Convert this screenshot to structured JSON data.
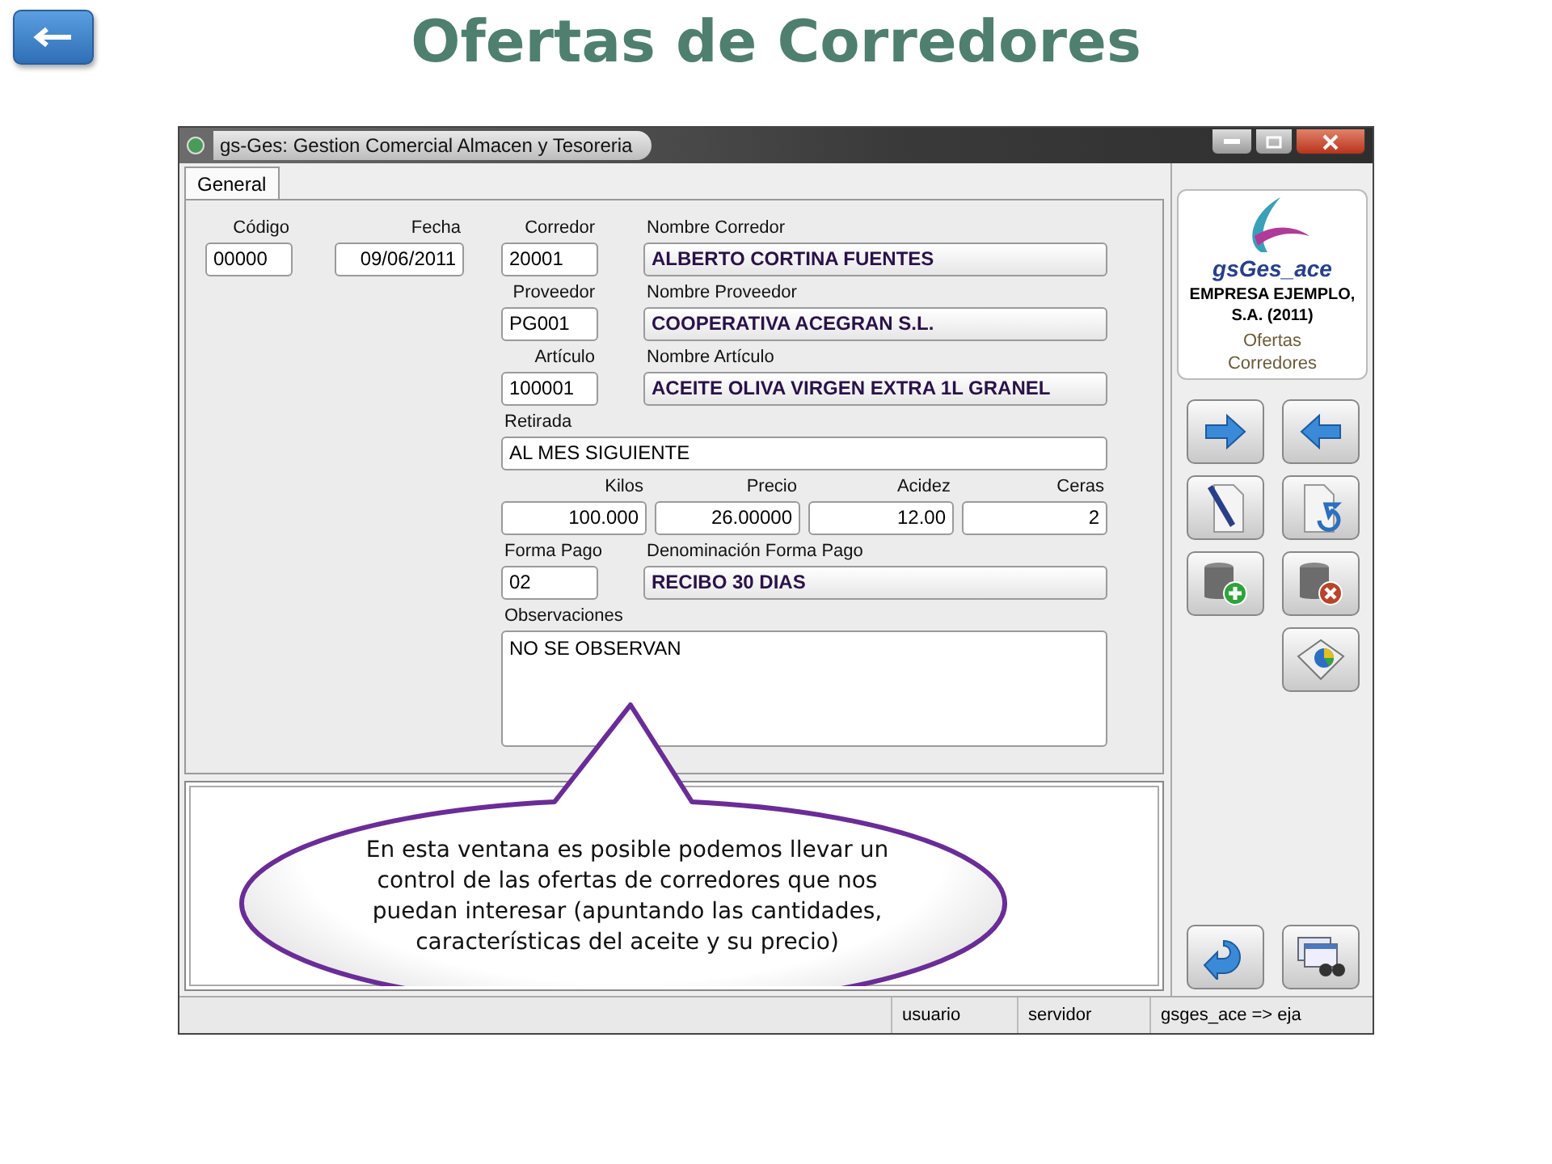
{
  "slide": {
    "title": "Ofertas de Corredores"
  },
  "window": {
    "title": "gs-Ges: Gestion Comercial Almacen y Tesoreria"
  },
  "tabs": [
    {
      "label": "General",
      "selected": true
    }
  ],
  "header_fields": [
    {
      "label": "Código",
      "value": "00000",
      "kind": "code"
    },
    {
      "label": "Fecha",
      "value": "09/06/2011",
      "kind": "date"
    }
  ],
  "rows": [
    [
      {
        "label": "Corredor",
        "value": "20001",
        "kind": "code"
      },
      {
        "label": "Nombre Corredor",
        "value": "ALBERTO CORTINA FUENTES",
        "kind": "name"
      }
    ],
    [
      {
        "label": "Proveedor",
        "value": "PG001",
        "kind": "code"
      },
      {
        "label": "Nombre Proveedor",
        "value": "COOPERATIVA ACEGRAN S.L.",
        "kind": "name"
      }
    ],
    [
      {
        "label": "Artículo",
        "value": "100001",
        "kind": "code"
      },
      {
        "label": "Nombre Artículo",
        "value": "ACEITE OLIVA VIRGEN EXTRA 1L GRANEL",
        "kind": "name"
      }
    ],
    [
      {
        "label": "Retirada",
        "value": "AL MES SIGUIENTE",
        "kind": "text"
      }
    ],
    [
      {
        "label": "Kilos",
        "value": "100.000",
        "kind": "number"
      },
      {
        "label": "Precio",
        "value": "26.00000",
        "kind": "number"
      },
      {
        "label": "Acidez",
        "value": "12.00",
        "kind": "number"
      },
      {
        "label": "Ceras",
        "value": "2",
        "kind": "number"
      }
    ],
    [
      {
        "label": "Forma Pago",
        "value": "02",
        "kind": "code"
      },
      {
        "label": "Denominación Forma Pago",
        "value": "RECIBO 30 DIAS",
        "kind": "name"
      }
    ],
    [
      {
        "label": "Observaciones",
        "value": "NO SE OBSERVAN",
        "kind": "memo"
      }
    ]
  ],
  "sidebar": {
    "logo": "gsGes_ace",
    "company": "EMPRESA EJEMPLO, S.A. (2011)",
    "module": "Ofertas Corredores"
  },
  "status_bar": [
    "usuario",
    "servidor",
    "gsges_ace => eja"
  ],
  "callout": "En esta ventana es posible podemos llevar un control de las ofertas de corredores que nos puedan interesar (apuntando las cantidades, características del aceite y su precio)"
}
